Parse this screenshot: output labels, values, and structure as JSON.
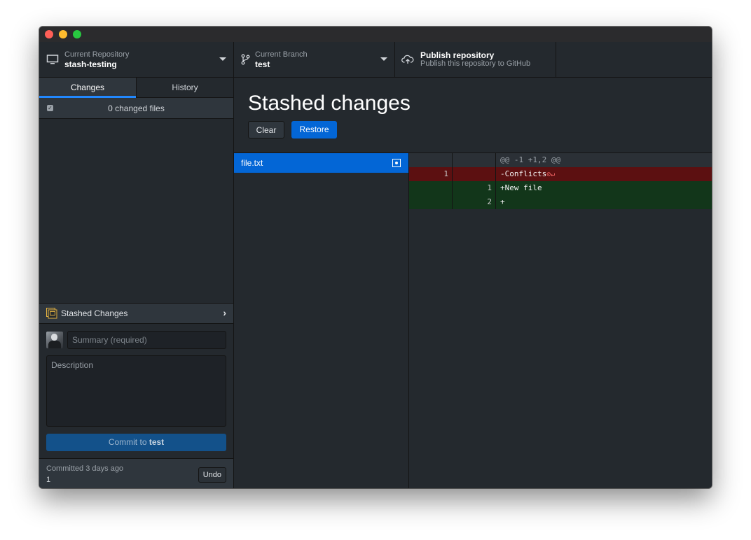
{
  "toolbar": {
    "repository": {
      "label": "Current Repository",
      "value": "stash-testing",
      "icon": "computer-icon"
    },
    "branch": {
      "label": "Current Branch",
      "value": "test",
      "icon": "branch-icon"
    },
    "publish": {
      "label": "Publish repository",
      "value": "Publish this repository to GitHub",
      "icon": "cloud-upload-icon"
    }
  },
  "sidebar": {
    "tabs": [
      {
        "label": "Changes",
        "active": true
      },
      {
        "label": "History",
        "active": false
      }
    ],
    "changed_files": "0 changed files",
    "stashed_label": "Stashed Changes",
    "summary_placeholder": "Summary (required)",
    "description_placeholder": "Description",
    "commit_prefix": "Commit to ",
    "commit_branch": "test",
    "footer": {
      "label": "Committed 3 days ago",
      "value": "1",
      "undo": "Undo"
    }
  },
  "main": {
    "title": "Stashed changes",
    "clear_label": "Clear",
    "restore_label": "Restore",
    "files": [
      {
        "name": "file.txt",
        "status": "modified"
      }
    ],
    "diff": {
      "hunk": "@@ -1 +1,2 @@",
      "lines": [
        {
          "type": "del",
          "old": "1",
          "new": "",
          "text": "-Conflicts",
          "no_newline": true
        },
        {
          "type": "add",
          "old": "",
          "new": "1",
          "text": "+New file"
        },
        {
          "type": "add",
          "old": "",
          "new": "2",
          "text": "+"
        }
      ],
      "no_newline_marker": "⊘↵"
    }
  },
  "colors": {
    "accent": "#0366d6",
    "deleted": "#5c1011",
    "added": "#12361a",
    "background": "#24292e"
  }
}
